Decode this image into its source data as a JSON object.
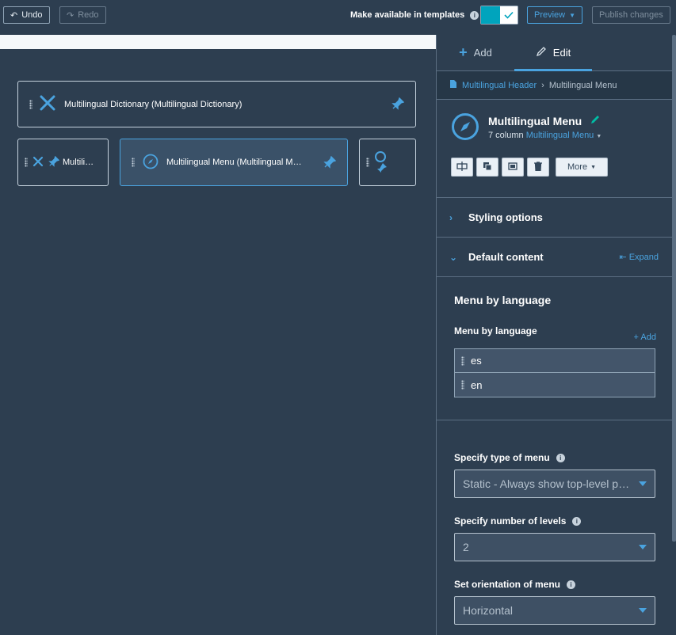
{
  "topbar": {
    "undo": "Undo",
    "redo": "Redo",
    "templates_label": "Make available in templates",
    "preview": "Preview",
    "publish": "Publish changes"
  },
  "canvas": {
    "module_dictionary": "Multilingual Dictionary (Multilingual Dictionary)",
    "module_small": "Multili…",
    "module_menu": "Multilingual Menu (Multilingual M…"
  },
  "panel": {
    "tabs": {
      "add": "Add",
      "edit": "Edit"
    },
    "breadcrumb": {
      "parent": "Multilingual Header",
      "current": "Multilingual Menu"
    },
    "module": {
      "title": "Multilingual Menu",
      "columns": "7 column",
      "type": "Multilingual Menu",
      "more": "More"
    },
    "sections": {
      "styling": "Styling options",
      "default_content": "Default content",
      "expand": "Expand"
    },
    "menu_group": {
      "heading": "Menu by language",
      "label": "Menu by language",
      "add": "+ Add",
      "items": [
        "es",
        "en"
      ]
    },
    "fields": {
      "type_label": "Specify type of menu",
      "type_value": "Static - Always show top-level pages in menu",
      "levels_label": "Specify number of levels",
      "levels_value": "2",
      "orientation_label": "Set orientation of menu",
      "orientation_value": "Horizontal"
    }
  },
  "colors": {
    "accent": "#4aa3df",
    "toggle": "#00a4bd",
    "bg": "#2d3e50"
  }
}
